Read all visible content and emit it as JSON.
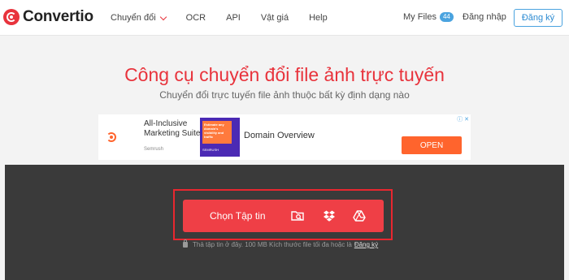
{
  "header": {
    "brand": "Convertio",
    "nav": [
      "Chuyển đổi",
      "OCR",
      "API",
      "Vật giá",
      "Help"
    ],
    "my_files_label": "My Files",
    "my_files_count": "44",
    "login_label": "Đăng nhập",
    "signup_label": "Đăng ký"
  },
  "hero": {
    "title": "Công cụ chuyển đổi file ảnh trực tuyến",
    "subtitle": "Chuyển đổi trực tuyến file ảnh thuộc bất kỳ định dạng nào"
  },
  "ad": {
    "brand_text": "All-Inclusive Marketing Suite",
    "brand_small": "Semrush",
    "image_text": "Estimate any domain's visibility and traffic",
    "image_footer": "SEMRUSH",
    "headline": "Domain Overview",
    "cta": "OPEN",
    "close": "ⓘ ✕"
  },
  "upload": {
    "choose_label": "Chọn Tập tin",
    "hint": "Thả tập tin ở đây. 100 MB Kích thước file tối đa hoặc là",
    "hint_link": "Đăng ký"
  },
  "colors": {
    "accent": "#e8333c",
    "button": "#ef3f46",
    "upload_bg": "#3a3a3a",
    "link_blue": "#4aa3df"
  },
  "icons": [
    "logo-icon",
    "chevron-down-icon",
    "folder-search-icon",
    "dropbox-icon",
    "google-drive-icon",
    "lock-icon"
  ]
}
